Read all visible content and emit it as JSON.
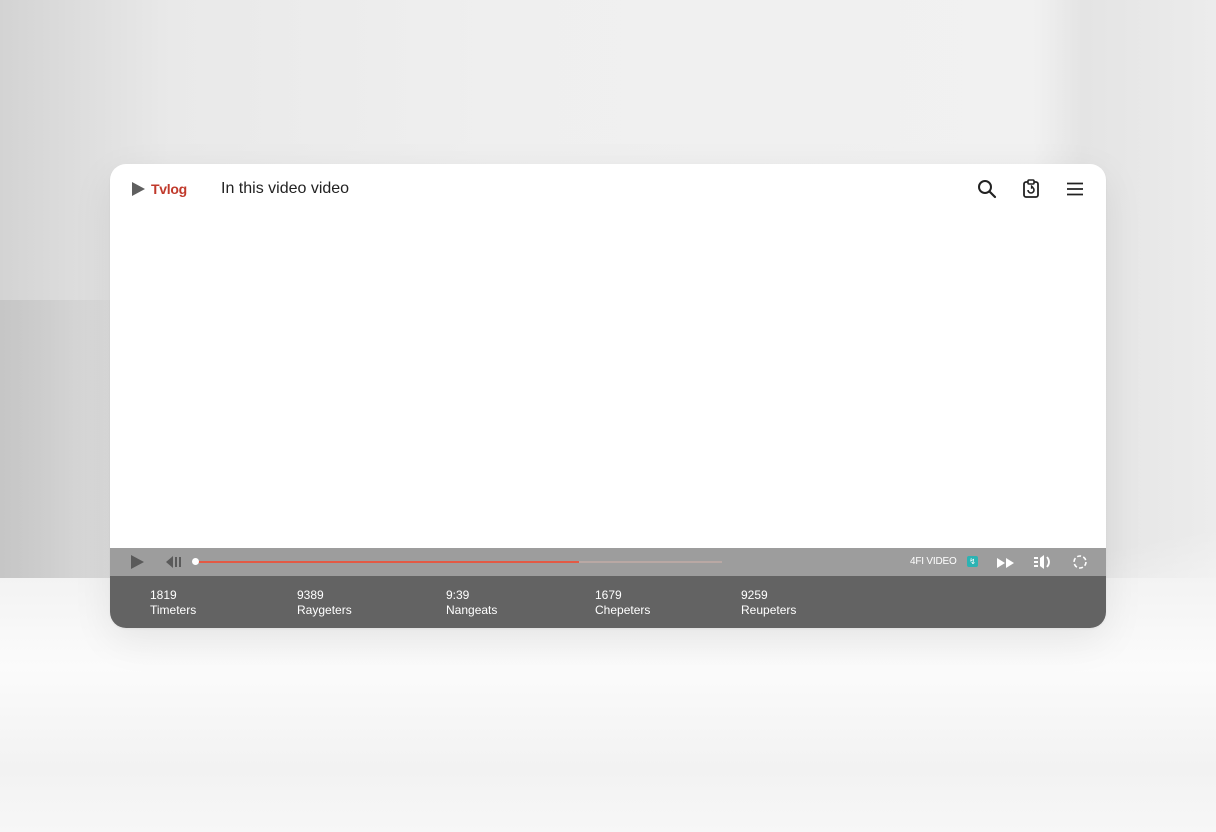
{
  "header": {
    "logo_text": "Tvlog",
    "title": "In this video video"
  },
  "icons": {
    "search": "search-icon",
    "clipboard": "clipboard-icon",
    "menu": "menu-icon"
  },
  "player": {
    "progress_fraction": 0.73,
    "buffered_fraction": 1.0,
    "quality_label": "4FI VIDEO",
    "quality_badge": "↯",
    "colors": {
      "progress": "#e35a45",
      "controls_bg": "#9d9d9d",
      "chapters_bg": "#636363",
      "badge": "#2cb3b3",
      "logo": "#c0392b"
    }
  },
  "chapters": [
    {
      "time": "1819",
      "label": "Timeters"
    },
    {
      "time": "9389",
      "label": "Raygeters"
    },
    {
      "time": "9:39",
      "label": "Nangeats"
    },
    {
      "time": "1679",
      "label": "Chepeters"
    },
    {
      "time": "9259",
      "label": "Reupeters"
    }
  ]
}
